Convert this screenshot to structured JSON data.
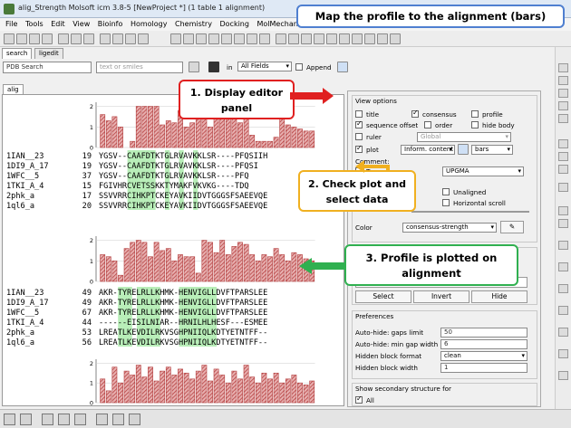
{
  "window": {
    "title": "alig_Strength Molsoft icm 3.8-5  [NewProject *] (1 table 1 alignment)"
  },
  "menu": [
    "File",
    "Tools",
    "Edit",
    "View",
    "Bioinfo",
    "Homology",
    "Chemistry",
    "Docking",
    "MolMechanics",
    "Windows",
    "Help"
  ],
  "tabs": {
    "search": "search",
    "ligedit": "ligedit",
    "alig": "alig"
  },
  "search": {
    "source": "PDB Search",
    "placeholder": "text or smiles",
    "in_label": "in",
    "field": "All Fields",
    "append_label": "Append"
  },
  "sequences_block1": [
    {
      "name": "1IAN__23",
      "start": "19",
      "seq": "YGSV--CAAFDTKTGLRVAVKKLSR----PFQSIIH"
    },
    {
      "name": "1DI9_A_17",
      "start": "19",
      "seq": "YGSV--CAAFDTKTGLRVAVKKLSR----PFQSI"
    },
    {
      "name": "1WFC__5",
      "start": "37",
      "seq": "YGSV--CAAFDTKTGLRVAVKKLSR----PFQ"
    },
    {
      "name": "1TKI_A_4",
      "start": "15",
      "seq": "FGIVHRCVETSSKKTYMAKFVKVKG----TDQ"
    },
    {
      "name": "2phk_a",
      "start": "17",
      "seq": "SSVVRRCIHKPTCKEYAVKIIDVTGGGSFSAEEVQE"
    },
    {
      "name": "1ql6_a",
      "start": "20",
      "seq": "SSVVRRCIHKPTCKEYAVKIIDVTGGGSFSAEEVQE"
    }
  ],
  "sequences_block2": [
    {
      "name": "1IAN__23",
      "start": "49",
      "seq": "AKR-TYRELRLLKHMK-HENVIGLLDVFTPARSLEE"
    },
    {
      "name": "1DI9_A_17",
      "start": "49",
      "seq": "AKR-TYRELRLLKHMK-HENVIGLLDVFTPARSLEE"
    },
    {
      "name": "1WFC__5",
      "start": "67",
      "seq": "AKR-TYRELRLLKHMK-HENVIGLLDVFTPARSLEE"
    },
    {
      "name": "1TKI_A_4",
      "start": "44",
      "seq": "------EISILNIAR--HRNILHLHESF---ESMEE"
    },
    {
      "name": "2phk_a",
      "start": "53",
      "seq": "LREATLKEVDILRKVSGHPNIIQLKDTYETNTFF--"
    },
    {
      "name": "1ql6_a",
      "start": "56",
      "seq": "LREATLKEVDILRKVSGHPNIIQLKDTYETNTFF--"
    }
  ],
  "profile_axis": [
    "2",
    "1",
    "0"
  ],
  "view_options": {
    "heading": "View options",
    "title": "title",
    "consensus": "consensus",
    "profile": "profile",
    "sequence_offset": "sequence offset",
    "order": "order",
    "hide_body": "hide body",
    "ruler": "ruler",
    "ruler_value": "Global",
    "plot": "plot",
    "plot_value": "Inform. content",
    "plot_style": "bars",
    "comment_label": "Comment:",
    "tree": "Tree",
    "tree_value": "UPGMA",
    "unaligned": "Unaligned",
    "horizontal_scroll": "Horizontal scroll",
    "color": "Color",
    "color_value": "consensus-strength"
  },
  "selection": {
    "select": "Select",
    "invert": "Invert",
    "hide": "Hide"
  },
  "preferences": {
    "heading": "Preferences",
    "rows": [
      {
        "label": "Auto-hide: gaps limit",
        "value": "50"
      },
      {
        "label": "Auto-hide: min gap width",
        "value": "6"
      },
      {
        "label": "Hidden block format",
        "value": "clean"
      },
      {
        "label": "Hidden block width",
        "value": "1"
      }
    ]
  },
  "secondary": {
    "heading": "Show secondary structure for",
    "all": "All"
  },
  "callouts": {
    "banner": "Map the profile to the alignment (bars)",
    "c1": "1. Display editor panel",
    "c2": "2. Check plot and select data",
    "c3": "3. Profile is plotted on alignment"
  },
  "colors": {
    "bar": "#b23a3a",
    "highlight_green": "#7ee07e",
    "highlight_dark": "#2ca05a",
    "callout_red": "#e02020",
    "callout_orange": "#f0b020",
    "callout_green": "#30b050",
    "banner_blue": "#4f7fd0"
  },
  "chart_data": {
    "type": "bar",
    "title": "",
    "ylim": [
      0,
      2.2
    ],
    "yticks": [
      0,
      1,
      2
    ],
    "profiles": [
      {
        "values": [
          1.6,
          1.3,
          1.5,
          1.0,
          0.0,
          0.3,
          2.0,
          2.0,
          2.0,
          2.0,
          1.1,
          1.3,
          1.2,
          1.8,
          1.0,
          1.2,
          1.6,
          2.0,
          1.0,
          1.6,
          2.0,
          1.4,
          1.7,
          1.2,
          1.5,
          0.6,
          0.3,
          0.3,
          0.3,
          0.5,
          1.4,
          1.1,
          1.0,
          0.9,
          0.8,
          0.8
        ]
      },
      {
        "values": [
          1.3,
          1.2,
          1.0,
          0.3,
          1.6,
          1.9,
          2.0,
          1.9,
          1.2,
          1.9,
          1.5,
          1.6,
          1.0,
          1.3,
          1.2,
          1.2,
          0.4,
          2.0,
          1.9,
          1.4,
          2.0,
          1.3,
          1.7,
          1.9,
          1.8,
          1.3,
          1.0,
          1.3,
          1.2,
          1.6,
          1.3,
          1.0,
          1.4,
          1.3,
          1.1,
          1.0
        ]
      },
      {
        "values": [
          1.2,
          0.6,
          1.8,
          1.0,
          1.6,
          1.4,
          1.9,
          1.3,
          1.8,
          1.1,
          1.6,
          1.8,
          1.4,
          1.7,
          1.5,
          1.2,
          1.6,
          1.9,
          1.1,
          1.7,
          1.4,
          1.0,
          1.6,
          1.2,
          1.9,
          1.3,
          1.0,
          1.5,
          1.2,
          1.5,
          1.0,
          1.2,
          1.4,
          1.0,
          0.9,
          1.1
        ]
      }
    ]
  }
}
